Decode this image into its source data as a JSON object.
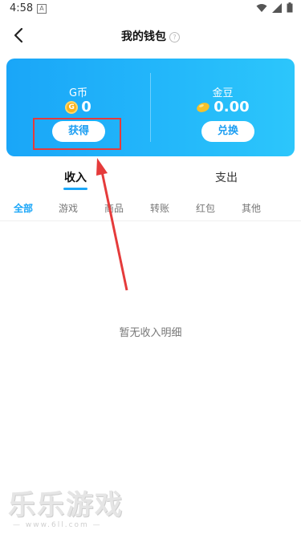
{
  "status": {
    "time": "4:58",
    "app_badge": "A"
  },
  "nav": {
    "title": "我的钱包",
    "help": "?"
  },
  "wallet": {
    "g_coin": {
      "label": "G币",
      "amount": "0",
      "button": "获得",
      "icon_letter": "G"
    },
    "gold_bean": {
      "label": "金豆",
      "amount": "0.00",
      "button": "兑换"
    }
  },
  "tabs": [
    {
      "label": "收入"
    },
    {
      "label": "支出"
    }
  ],
  "sub_tabs": [
    {
      "label": "全部"
    },
    {
      "label": "游戏"
    },
    {
      "label": "商品"
    },
    {
      "label": "转账"
    },
    {
      "label": "红包"
    },
    {
      "label": "其他"
    }
  ],
  "empty_message": "暂无收入明细",
  "watermark": {
    "title": "乐乐游戏",
    "url": "— www.6ll.com —"
  },
  "colors": {
    "accent": "#1aa6f8",
    "annotation": "#e53b3b"
  }
}
